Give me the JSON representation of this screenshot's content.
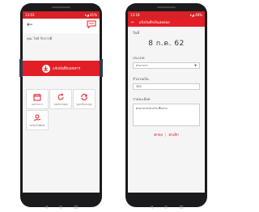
{
  "left_screen": {
    "statusbar": {
      "time": "13:03",
      "right": "▾◢ 41%"
    },
    "user_line": "คุณ ไชย์ รักการดี",
    "main_button_label": "แจ้งบันทึกเอกสาร",
    "tiles": [
      {
        "label": "ขอรายการ",
        "icon": "calendar-icon"
      },
      {
        "label": "ขอเบิกเงินสด",
        "icon": "refund-icon"
      },
      {
        "label": "ขอเปลี่ยนแปลง",
        "icon": "refresh-icon"
      },
      {
        "label": "ขอรับเงินพิเศษ",
        "icon": "hand-coin-icon"
      }
    ]
  },
  "right_screen": {
    "statusbar": {
      "time": "13:18",
      "right": "▾◢ 48%"
    },
    "appbar_title": "แจ้งบันทึกเงินสดย่อย",
    "date_label": "วันที่",
    "date_value": "8 ก.ค. 62",
    "category_label": "ประเภท",
    "category_value": "ค่าอาหาร",
    "amount_label": "จำนวนเงิน",
    "amount_value": "300",
    "detail_label": "รายละเอียด",
    "detail_value": "ค่าอาหารกลางวัน ทีมงาน",
    "save_label": "ตกลง",
    "cancel_label": "ยกเลิก"
  },
  "colors": {
    "brand_red": "#e41e26",
    "phone_body": "#1b1b1d",
    "nav_tab": "#2d3a52"
  }
}
